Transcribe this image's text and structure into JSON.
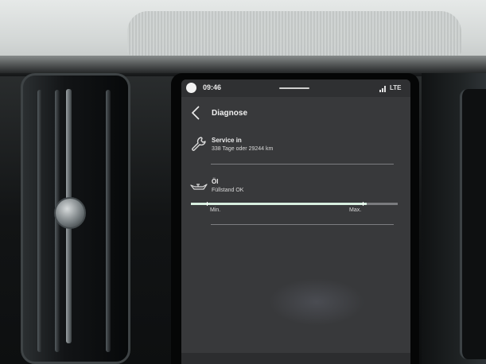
{
  "status_bar": {
    "time": "09:46",
    "network": "LTE"
  },
  "header": {
    "title": "Diagnose"
  },
  "service": {
    "title": "Service in",
    "detail": "338 Tage oder 29244 km",
    "icon": "wrench-icon"
  },
  "oil": {
    "title": "Öl",
    "status": "Füllstand OK",
    "icon": "oil-can-icon",
    "level_fraction": 0.85,
    "min_label": "Min.",
    "max_label": "Max."
  }
}
